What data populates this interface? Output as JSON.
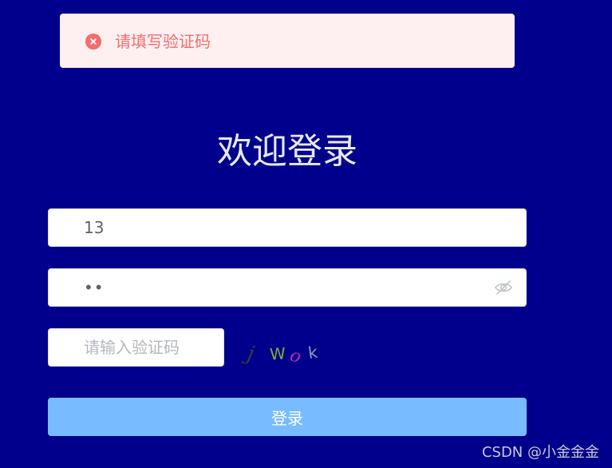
{
  "toast": {
    "type": "error",
    "icon": "close-circle-icon",
    "message": "请填写验证码",
    "color": "#f56c6c",
    "background": "#fef0f0"
  },
  "title": "欢迎登录",
  "phone": {
    "value": "13"
  },
  "password": {
    "masked_value": "••",
    "toggle_icon": "eye-off-icon"
  },
  "captcha": {
    "placeholder": "请输入验证码",
    "value": "",
    "image_text": "jWok"
  },
  "login_button": {
    "label": "登录",
    "color": "#79bbff"
  },
  "watermark": "CSDN @小金金金",
  "colors": {
    "page_background": "#00008c"
  }
}
